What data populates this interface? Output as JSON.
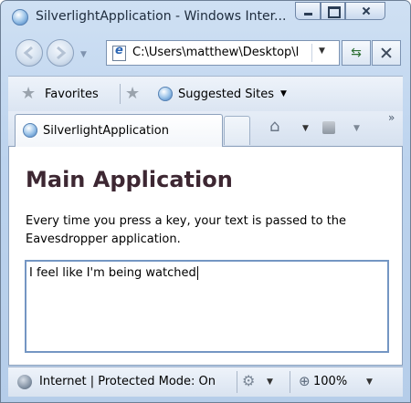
{
  "window": {
    "title": "SilverlightApplication - Windows Inter..."
  },
  "navigation": {
    "address": "C:\\Users\\matthew\\Desktop\\l"
  },
  "favorites_bar": {
    "favorites_label": "Favorites",
    "suggested_sites_label": "Suggested Sites"
  },
  "tabs": [
    {
      "label": "SilverlightApplication",
      "active": true
    }
  ],
  "page": {
    "title": "Main Application",
    "description": "Every time you press a key, your text is passed to the Eavesdropper application.",
    "textbox_value": "I feel like I'm being watched"
  },
  "status_bar": {
    "zone_text": "Internet | Protected Mode: On",
    "zoom": "100%"
  },
  "icons": {
    "app": "ie-icon",
    "back": "back-arrow-icon",
    "forward": "forward-arrow-icon",
    "refresh": "refresh-icon",
    "stop": "stop-icon",
    "home": "home-icon",
    "feeds": "rss-feed-icon",
    "zone": "globe-icon",
    "zoom": "magnifier-icon"
  }
}
